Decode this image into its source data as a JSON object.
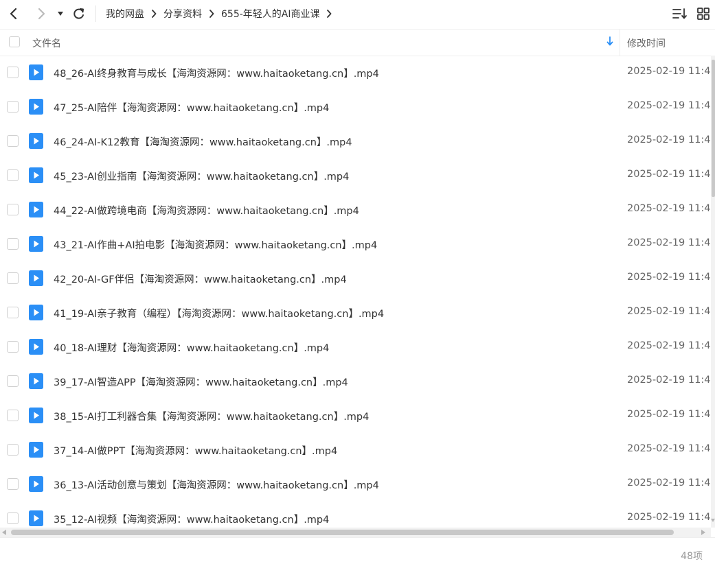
{
  "toolbar": {
    "back_icon": "chevron-left-icon",
    "forward_icon": "chevron-right-icon",
    "history_icon": "caret-down-icon",
    "refresh_icon": "refresh-icon",
    "breadcrumbs": [
      "我的网盘",
      "分享资料",
      "655-年轻人的AI商业课"
    ],
    "sort_icon": "sort-list-icon",
    "view_icon": "grid-view-icon"
  },
  "header": {
    "name_label": "文件名",
    "time_label": "修改时间",
    "sort_indicator": "arrow-down-icon",
    "accent": "#2b8ff6"
  },
  "files": [
    {
      "name": "48_26-AI终身教育与成长【海淘资源网：www.haitaoketang.cn】.mp4",
      "time": "2025-02-19 11:4"
    },
    {
      "name": "47_25-AI陪伴【海淘资源网：www.haitaoketang.cn】.mp4",
      "time": "2025-02-19 11:4"
    },
    {
      "name": "46_24-AI-K12教育【海淘资源网：www.haitaoketang.cn】.mp4",
      "time": "2025-02-19 11:4"
    },
    {
      "name": "45_23-AI创业指南【海淘资源网：www.haitaoketang.cn】.mp4",
      "time": "2025-02-19 11:4"
    },
    {
      "name": "44_22-AI做跨境电商【海淘资源网：www.haitaoketang.cn】.mp4",
      "time": "2025-02-19 11:4"
    },
    {
      "name": "43_21-AI作曲+AI拍电影【海淘资源网：www.haitaoketang.cn】.mp4",
      "time": "2025-02-19 11:4"
    },
    {
      "name": "42_20-AI-GF伴侣【海淘资源网：www.haitaoketang.cn】.mp4",
      "time": "2025-02-19 11:4"
    },
    {
      "name": "41_19-AI亲子教育（编程）【海淘资源网：www.haitaoketang.cn】.mp4",
      "time": "2025-02-19 11:4"
    },
    {
      "name": "40_18-AI理财【海淘资源网：www.haitaoketang.cn】.mp4",
      "time": "2025-02-19 11:4"
    },
    {
      "name": "39_17-AI智造APP【海淘资源网：www.haitaoketang.cn】.mp4",
      "time": "2025-02-19 11:4"
    },
    {
      "name": "38_15-AI打工利器合集【海淘资源网：www.haitaoketang.cn】.mp4",
      "time": "2025-02-19 11:4"
    },
    {
      "name": "37_14-AI做PPT【海淘资源网：www.haitaoketang.cn】.mp4",
      "time": "2025-02-19 11:4"
    },
    {
      "name": "36_13-AI活动创意与策划【海淘资源网：www.haitaoketang.cn】.mp4",
      "time": "2025-02-19 11:4"
    },
    {
      "name": "35_12-AI视频【海淘资源网：www.haitaoketang.cn】.mp4",
      "time": "2025-02-19 11:4"
    }
  ],
  "file_icon": "video-file-icon",
  "footer": {
    "count": "48项"
  }
}
